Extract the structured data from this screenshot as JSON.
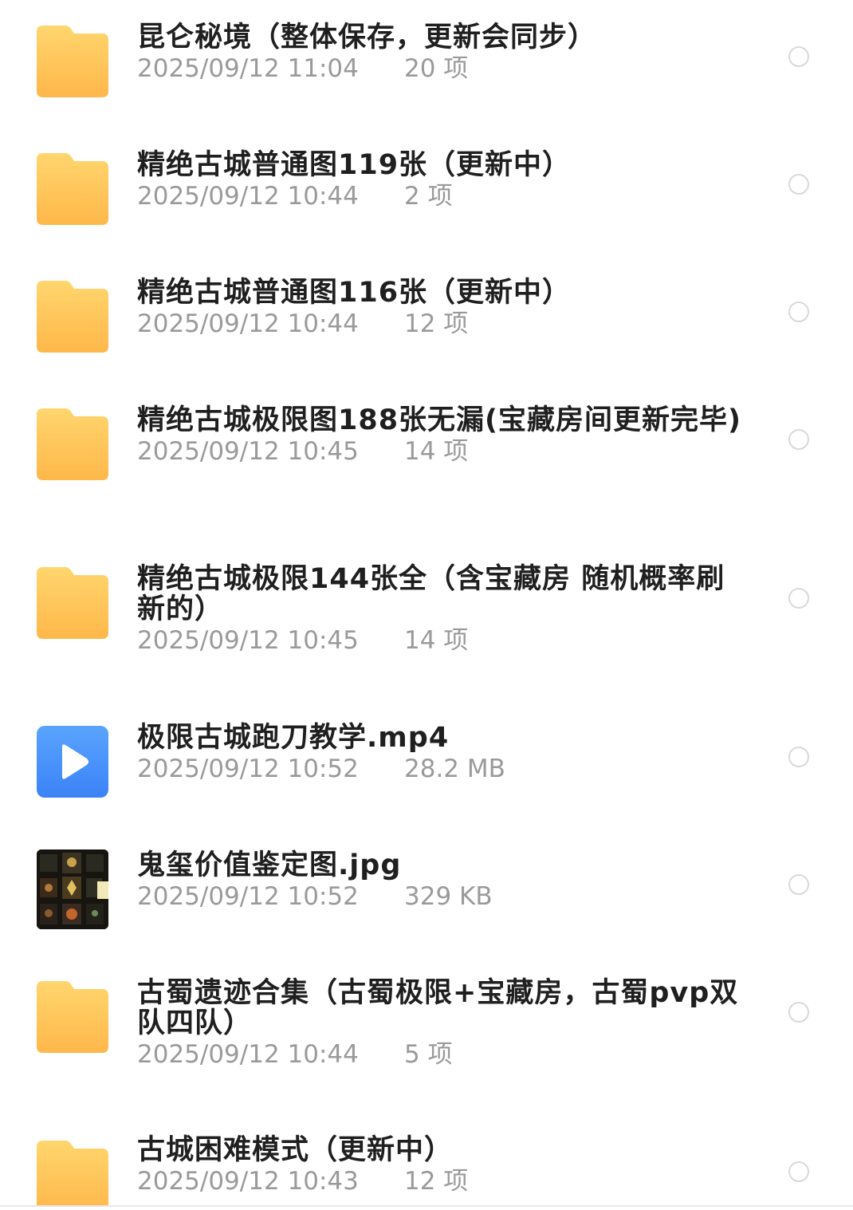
{
  "items": [
    {
      "name": "昆仑秘境（整体保存，更新会同步）",
      "date": "2025/09/12  11:04",
      "size": "20  项",
      "type": "folder"
    },
    {
      "name": "精绝古城普通图119张（更新中）",
      "date": "2025/09/12  10:44",
      "size": "2  项",
      "type": "folder"
    },
    {
      "name": "精绝古城普通图116张（更新中）",
      "date": "2025/09/12  10:44",
      "size": "12  项",
      "type": "folder"
    },
    {
      "name": "精绝古城极限图188张无漏(宝藏房间更新完毕)",
      "date": "2025/09/12  10:45",
      "size": "14  项",
      "type": "folder"
    },
    {
      "name": "精绝古城极限144张全（含宝藏房  随机概率刷新的）",
      "date": "2025/09/12  10:45",
      "size": "14  项",
      "type": "folder"
    },
    {
      "name": "极限古城跑刀教学.mp4",
      "date": "2025/09/12  10:52",
      "size": "28.2  MB",
      "type": "video"
    },
    {
      "name": "鬼玺价值鉴定图.jpg",
      "date": "2025/09/12  10:52",
      "size": "329  KB",
      "type": "image"
    },
    {
      "name": "古蜀遗迹合集（古蜀极限+宝藏房，古蜀pvp双队四队）",
      "date": "2025/09/12  10:44",
      "size": "5  项",
      "type": "folder"
    },
    {
      "name": "古城困难模式（更新中）",
      "date": "2025/09/12  10:43",
      "size": "12  项",
      "type": "folder"
    }
  ],
  "colors": {
    "folder_top": "#ffd66e",
    "folder_bottom": "#ffb74a",
    "video_blue": "#3b82f6",
    "title_text": "#1f1f1f",
    "meta_text": "#9a9a9a",
    "radio_border": "#d9d9d9"
  },
  "icons": {
    "folder": "folder-icon",
    "video": "video-play-icon",
    "image": "image-thumbnail"
  }
}
